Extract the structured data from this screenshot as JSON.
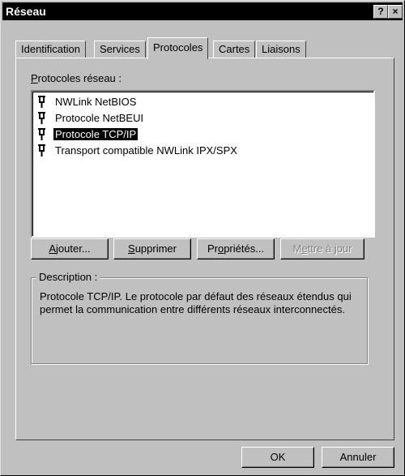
{
  "window": {
    "title": "Réseau",
    "help_label": "?",
    "close_label": "×"
  },
  "tabs": [
    {
      "label": "Identification",
      "active": false
    },
    {
      "label": "Services",
      "active": false
    },
    {
      "label": "Protocoles",
      "active": true
    },
    {
      "label": "Cartes",
      "active": false
    },
    {
      "label": "Liaisons",
      "active": false
    }
  ],
  "protocols": {
    "label_mnemonic": "P",
    "label_rest": "rotocoles réseau :",
    "items": [
      {
        "label": "NWLink NetBIOS",
        "selected": false,
        "icon": "network-protocol-icon"
      },
      {
        "label": "Protocole NetBEUI",
        "selected": false,
        "icon": "network-protocol-icon"
      },
      {
        "label": "Protocole TCP/IP",
        "selected": true,
        "icon": "network-protocol-icon"
      },
      {
        "label": "Transport compatible NWLink IPX/SPX",
        "selected": false,
        "icon": "network-protocol-icon"
      }
    ]
  },
  "actions": {
    "add": {
      "mn": "A",
      "rest": "jouter..."
    },
    "remove": {
      "mn": "S",
      "rest": "upprimer"
    },
    "properties": {
      "pre": "Pr",
      "mn": "o",
      "rest": "priétés..."
    },
    "update": {
      "pre": "M",
      "mn": "e",
      "rest": "ttre à jour",
      "disabled": true
    }
  },
  "description": {
    "legend": "Description :",
    "text": "Protocole TCP/IP. Le protocole par défaut des réseaux étendus qui permet la communication entre différents réseaux interconnectés."
  },
  "footer": {
    "ok_label": "OK",
    "cancel_label": "Annuler"
  }
}
